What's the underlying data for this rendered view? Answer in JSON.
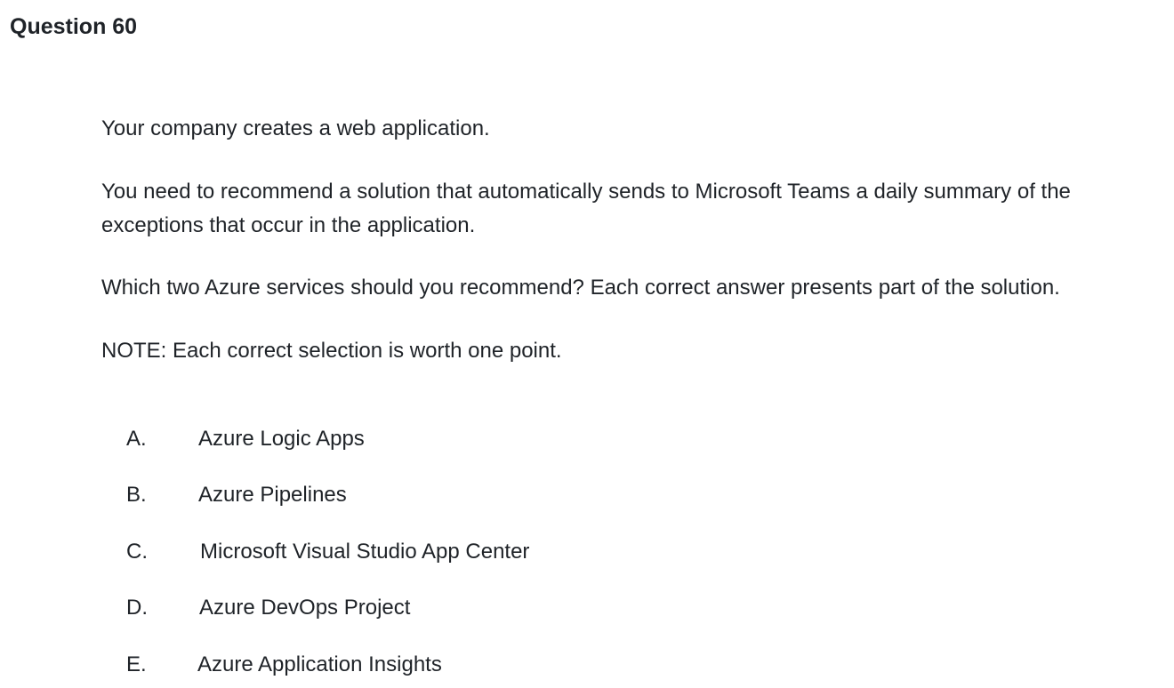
{
  "question": {
    "title": "Question 60",
    "paragraphs": [
      "Your company creates a web application.",
      "You need to recommend a solution that automatically sends to Microsoft Teams a daily summary of the",
      "exceptions that occur in the application.",
      "Which two Azure services should you recommend? Each correct answer presents part of the solution.",
      "NOTE: Each correct selection is worth one point."
    ],
    "options": [
      {
        "letter": "A.",
        "text": "Azure Logic Apps"
      },
      {
        "letter": "B.",
        "text": "Azure Pipelines"
      },
      {
        "letter": "C.",
        "text": "Microsoft Visual Studio App Center"
      },
      {
        "letter": "D.",
        "text": "Azure DevOps Project"
      },
      {
        "letter": "E.",
        "text": "Azure Application Insights"
      }
    ]
  }
}
